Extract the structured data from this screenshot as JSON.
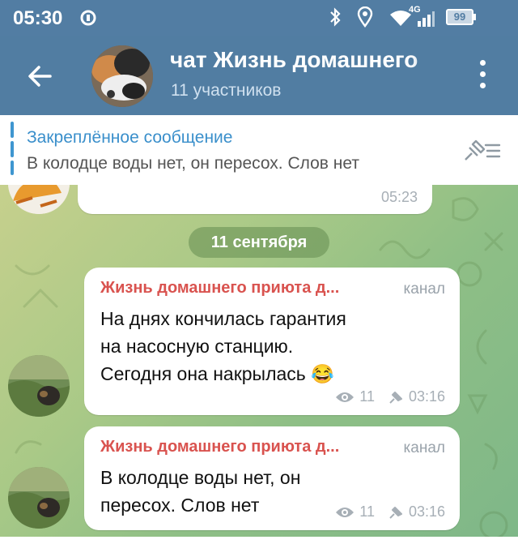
{
  "status_bar": {
    "time": "05:30",
    "icons": [
      "sync-icon",
      "bluetooth-icon",
      "location-icon",
      "wifi-icon",
      "signal-icon",
      "battery-icon"
    ],
    "network": "4G",
    "battery": "99"
  },
  "header": {
    "title": "чат Жизнь домашнего",
    "subtitle": "11 участников",
    "back_icon": "arrow-left-icon",
    "menu_icon": "more-vert-icon",
    "color": "#517da2"
  },
  "pinned": {
    "title": "Закреплённое сообщение",
    "text": "В колодце воды нет, он пересох. Слов нет",
    "accent": "#3a8fcb"
  },
  "chat": {
    "prev_message_time": "05:23",
    "date_separator": "11 сентября",
    "messages": [
      {
        "author": "Жизнь домашнего приюта д...",
        "tag": "канал",
        "text": "На днях кончилась гарантия\nна насосную станцию.\nСегодня она накрылась 😂",
        "views": "11",
        "time": "03:16"
      },
      {
        "author": "Жизнь домашнего приюта д...",
        "tag": "канал",
        "text": "В колодце воды нет, он\nпересох. Слов нет",
        "views": "11",
        "time": "03:16"
      }
    ],
    "author_color": "#d9534f"
  }
}
